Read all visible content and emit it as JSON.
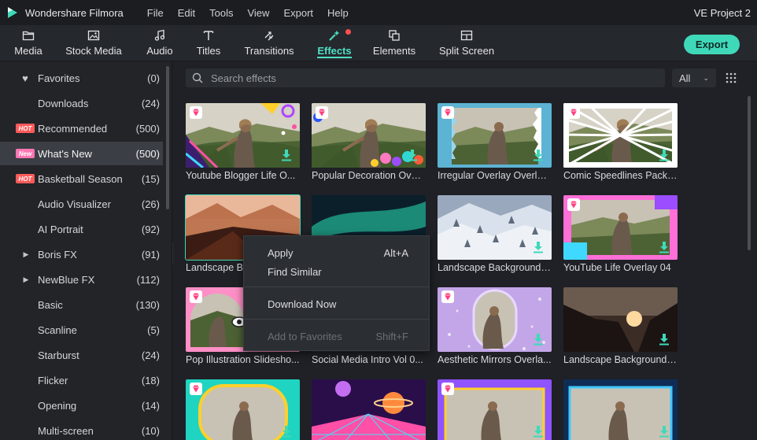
{
  "app": {
    "title": "Wondershare Filmora",
    "project": "VE Project 2"
  },
  "menu": [
    "File",
    "Edit",
    "Tools",
    "View",
    "Export",
    "Help"
  ],
  "toolbar": {
    "tabs": [
      {
        "label": "Media",
        "icon": "folder-icon"
      },
      {
        "label": "Stock Media",
        "icon": "image-icon"
      },
      {
        "label": "Audio",
        "icon": "music-note-icon"
      },
      {
        "label": "Titles",
        "icon": "text-t-icon"
      },
      {
        "label": "Transitions",
        "icon": "transition-icon"
      },
      {
        "label": "Effects",
        "icon": "effects-wand-icon",
        "active": true,
        "badge": true
      },
      {
        "label": "Elements",
        "icon": "elements-icon"
      },
      {
        "label": "Split Screen",
        "icon": "split-screen-icon"
      }
    ],
    "export_label": "Export"
  },
  "colors": {
    "accent": "#3fd9b9",
    "hot": "#ff5a5a",
    "new": "#ff76b4",
    "premium_gem": "#ff3d7f"
  },
  "sidebar": {
    "items": [
      {
        "label": "Favorites",
        "count": "(0)",
        "marker": "heart"
      },
      {
        "label": "Downloads",
        "count": "(24)",
        "marker": ""
      },
      {
        "label": "Recommended",
        "count": "(500)",
        "marker": "hot",
        "marker_text": "HOT"
      },
      {
        "label": "What's New",
        "count": "(500)",
        "marker": "new",
        "marker_text": "New",
        "selected": true
      },
      {
        "label": "Basketball Season",
        "count": "(15)",
        "marker": "hot",
        "marker_text": "HOT"
      },
      {
        "label": "Audio Visualizer",
        "count": "(26)",
        "marker": ""
      },
      {
        "label": "AI Portrait",
        "count": "(92)",
        "marker": ""
      },
      {
        "label": "Boris FX",
        "count": "(91)",
        "marker": "caret"
      },
      {
        "label": "NewBlue FX",
        "count": "(112)",
        "marker": "caret"
      },
      {
        "label": "Basic",
        "count": "(130)",
        "marker": ""
      },
      {
        "label": "Scanline",
        "count": "(5)",
        "marker": ""
      },
      {
        "label": "Starburst",
        "count": "(24)",
        "marker": ""
      },
      {
        "label": "Flicker",
        "count": "(18)",
        "marker": ""
      },
      {
        "label": "Opening",
        "count": "(14)",
        "marker": ""
      },
      {
        "label": "Multi-screen",
        "count": "(10)",
        "marker": ""
      }
    ]
  },
  "search": {
    "placeholder": "Search effects",
    "filter": "All"
  },
  "effects": [
    {
      "title": "Youtube Blogger Life O...",
      "style": "blogger"
    },
    {
      "title": "Popular Decoration Over...",
      "style": "decoration"
    },
    {
      "title": "Irregular Overlay Overlay...",
      "style": "irregular"
    },
    {
      "title": "Comic Speedlines Pack ...",
      "style": "speedlines"
    },
    {
      "title": "Landscape Ba",
      "style": "sunset",
      "selected": true
    },
    {
      "title": "",
      "style": "aurora"
    },
    {
      "title": "Landscape Backgrounds...",
      "style": "snow"
    },
    {
      "title": "YouTube Life Overlay 04",
      "style": "ytlife"
    },
    {
      "title": "Pop Illustration Slidesho...",
      "style": "pop"
    },
    {
      "title": "Social Media Intro Vol 0...",
      "style": "social"
    },
    {
      "title": "Aesthetic Mirrors Overla...",
      "style": "mirrors"
    },
    {
      "title": "Landscape Backgrounds...",
      "style": "canyon"
    },
    {
      "title": "",
      "style": "greenframe"
    },
    {
      "title": "",
      "style": "retro"
    },
    {
      "title": "",
      "style": "purpleframe"
    },
    {
      "title": "",
      "style": "blueframe"
    }
  ],
  "context_menu": {
    "items": [
      {
        "label": "Apply",
        "shortcut": "Alt+A",
        "enabled": true
      },
      {
        "label": "Find Similar",
        "shortcut": "",
        "enabled": true
      },
      {
        "label": "Download Now",
        "shortcut": "",
        "enabled": true
      },
      {
        "label": "Add to Favorites",
        "shortcut": "Shift+F",
        "enabled": false
      }
    ]
  }
}
